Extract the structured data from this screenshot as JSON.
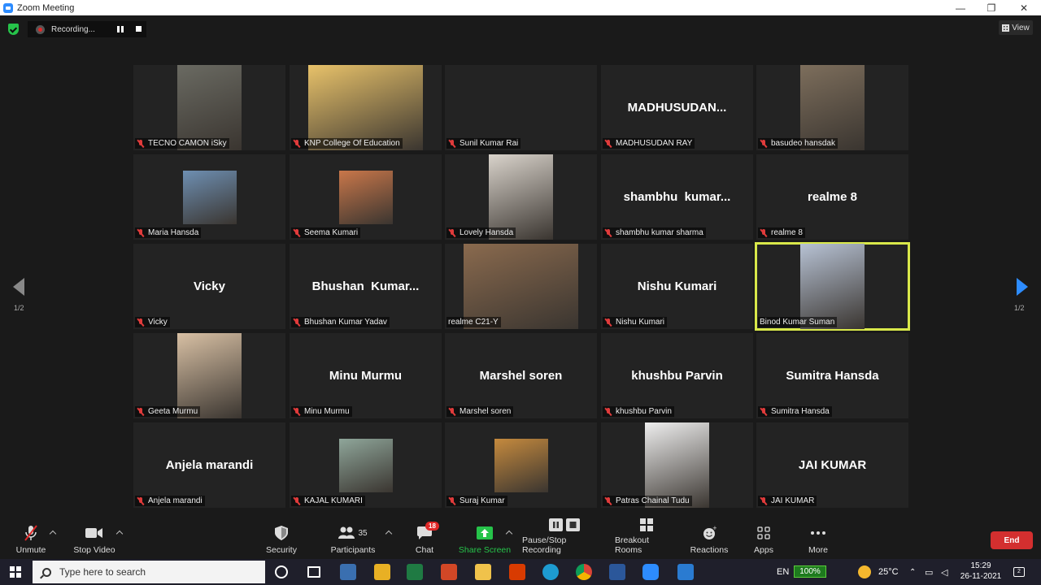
{
  "window": {
    "title": "Zoom Meeting",
    "minimize": "—",
    "maximize": "❐",
    "close": "✕"
  },
  "recording": {
    "label": "Recording..."
  },
  "view": {
    "label": "View"
  },
  "pagination": {
    "left": "1/2",
    "right": "1/2"
  },
  "tiles": [
    {
      "name": "TECNO CAMON iSky",
      "big": "",
      "video": true,
      "color": "#6a6a62"
    },
    {
      "name": "KNP College Of Education",
      "big": "",
      "video": true,
      "color": "#e8c26a"
    },
    {
      "name": "Sunil Kumar Rai",
      "big": "",
      "video": false
    },
    {
      "name": "MADHUSUDAN RAY",
      "big": "MADHUSUDAN...",
      "video": false
    },
    {
      "name": "basudeo hansdak",
      "big": "",
      "video": true,
      "color": "#7d6e5c"
    },
    {
      "name": "Maria Hansda",
      "big": "",
      "video": true,
      "color": "#6e8fb2"
    },
    {
      "name": "Seema Kumari",
      "big": "",
      "video": true,
      "color": "#c9774a"
    },
    {
      "name": "Lovely Hansda",
      "big": "",
      "video": true,
      "color": "#d9d3cb"
    },
    {
      "name": "shambhu kumar sharma",
      "big": "shambhu  kumar...",
      "video": false
    },
    {
      "name": "realme 8",
      "big": "realme 8",
      "video": false
    },
    {
      "name": "Vicky",
      "big": "Vicky",
      "video": false
    },
    {
      "name": "Bhushan Kumar Yadav",
      "big": "Bhushan  Kumar...",
      "video": false
    },
    {
      "name": "realme C21-Y",
      "big": "",
      "video": true,
      "color": "#8a6a4e"
    },
    {
      "name": "Nishu Kumari",
      "big": "Nishu Kumari",
      "video": false
    },
    {
      "name": "Binod Kumar Suman",
      "big": "",
      "video": true,
      "color": "#b7c2d4",
      "active": true
    },
    {
      "name": "Geeta Murmu",
      "big": "",
      "video": true,
      "color": "#d8c0a4"
    },
    {
      "name": "Minu Murmu",
      "big": "Minu Murmu",
      "video": false
    },
    {
      "name": "Marshel soren",
      "big": "Marshel soren",
      "video": false
    },
    {
      "name": "khushbu Parvin",
      "big": "khushbu Parvin",
      "video": false
    },
    {
      "name": "Sumitra Hansda",
      "big": "Sumitra Hansda",
      "video": false
    },
    {
      "name": "Anjela marandi",
      "big": "Anjela marandi",
      "video": false
    },
    {
      "name": "KAJAL KUMARI",
      "big": "",
      "video": true,
      "color": "#8fa69a"
    },
    {
      "name": "Suraj Kumar",
      "big": "",
      "video": true,
      "color": "#c58a3e"
    },
    {
      "name": "Patras Chainal Tudu",
      "big": "",
      "video": true,
      "color": "#eeeeee"
    },
    {
      "name": "JAI KUMAR",
      "big": "JAI KUMAR",
      "video": false
    }
  ],
  "toolbar": {
    "unmute": "Unmute",
    "stop_video": "Stop Video",
    "security": "Security",
    "participants": "Participants",
    "participants_count": "35",
    "chat": "Chat",
    "chat_badge": "18",
    "share_screen": "Share Screen",
    "recording": "Pause/Stop Recording",
    "breakout": "Breakout Rooms",
    "reactions": "Reactions",
    "apps": "Apps",
    "more": "More",
    "end": "End"
  },
  "taskbar": {
    "search_placeholder": "Type here to search",
    "language": "EN",
    "battery": "100%",
    "temperature": "25°C",
    "time": "15:29",
    "date": "26-11-2021",
    "notifications": "2"
  },
  "colors": {
    "accent": "#2d8cff",
    "active_speaker": "#d9e84a",
    "end": "#d32f2f",
    "share": "#26c34a"
  }
}
